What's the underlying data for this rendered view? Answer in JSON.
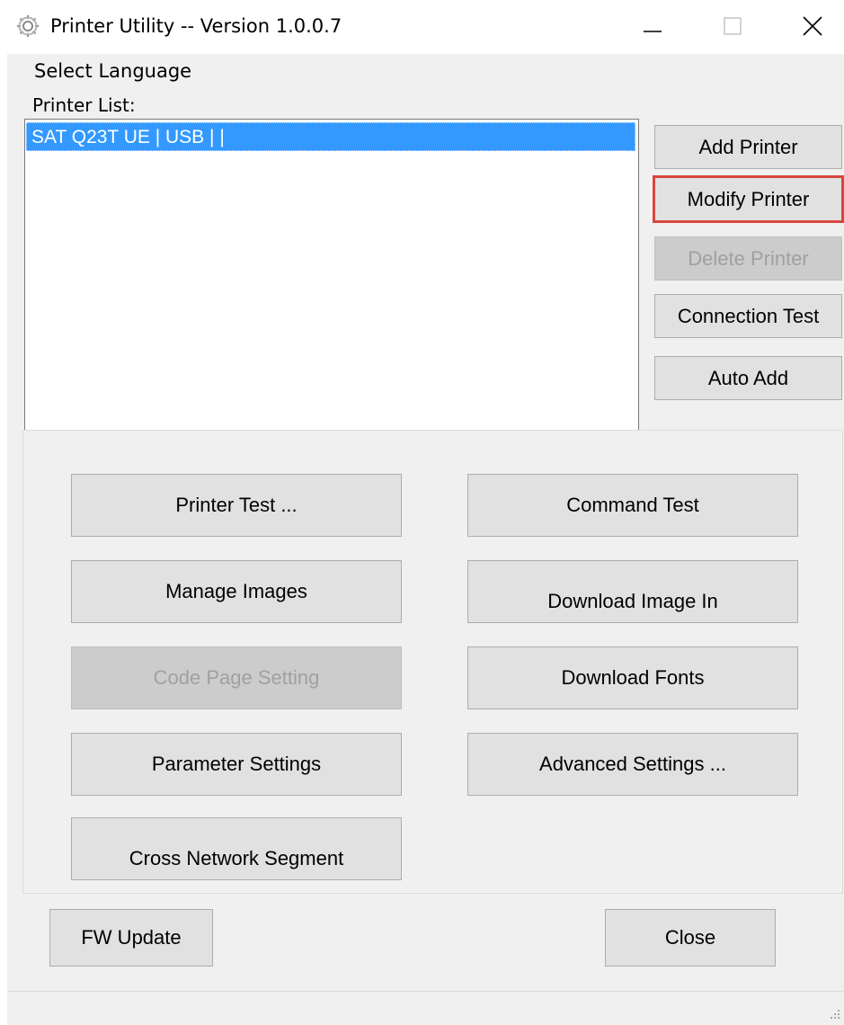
{
  "window": {
    "title": "Printer Utility -- Version 1.0.0.7"
  },
  "menu": {
    "select_language": "Select Language"
  },
  "printer_list": {
    "label": "Printer List:",
    "items": [
      "SAT Q23T UE | USB |  |"
    ],
    "selected_index": 0
  },
  "side_buttons": {
    "add_printer": "Add Printer",
    "modify_printer": "Modify Printer",
    "delete_printer": "Delete Printer",
    "connection_test": "Connection Test",
    "auto_add": "Auto Add"
  },
  "tools": {
    "printer_test": "Printer Test ...",
    "command_test": "Command Test",
    "manage_images": "Manage Images",
    "download_image_in": "Download Image In",
    "code_page_setting": "Code Page Setting",
    "download_fonts": "Download Fonts",
    "parameter_settings": "Parameter Settings",
    "advanced_settings": "Advanced Settings ...",
    "cross_network_segment": "Cross Network Segment"
  },
  "footer": {
    "fw_update": "FW Update",
    "close": "Close"
  },
  "states": {
    "disabled": [
      "delete_printer",
      "code_page_setting"
    ],
    "highlighted": [
      "modify_printer"
    ]
  },
  "colors": {
    "selection": "#3399ff",
    "highlight_border": "#d9463c",
    "button_face": "#e1e1e1",
    "disabled_button_face": "#cccccc",
    "window_background": "#f0f0f0"
  },
  "icons": {
    "app": "gear-icon",
    "minimize": "minimize-icon",
    "maximize": "maximize-icon",
    "close": "close-icon",
    "resize": "resize-grip-icon"
  }
}
